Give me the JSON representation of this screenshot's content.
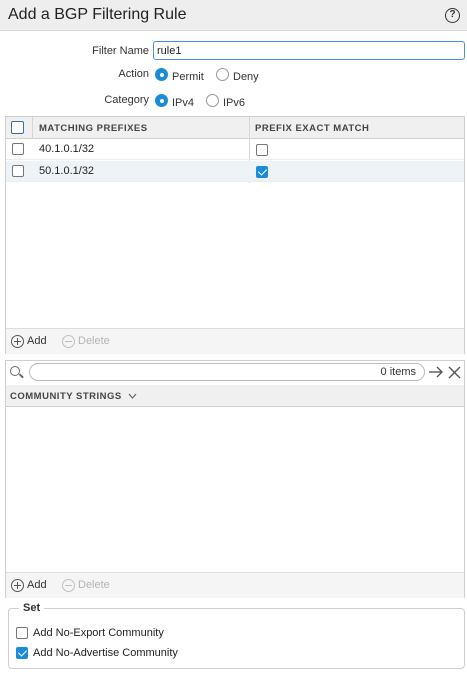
{
  "dialog": {
    "title": "Add a BGP Filtering Rule",
    "help_icon": "help-icon"
  },
  "form": {
    "filter_name_label": "Filter Name",
    "filter_name_value": "rule1",
    "action_label": "Action",
    "action_options": [
      "Permit",
      "Deny"
    ],
    "action_selected": "Permit",
    "category_label": "Category",
    "category_options": [
      "IPv4",
      "IPv6"
    ],
    "category_selected": "IPv4"
  },
  "prefix_grid": {
    "columns": [
      "MATCHING PREFIXES",
      "PREFIX EXACT MATCH"
    ],
    "rows": [
      {
        "prefix": "40.1.0.1/32",
        "exact_match": false
      },
      {
        "prefix": "50.1.0.1/32",
        "exact_match": true
      }
    ],
    "add_label": "Add",
    "delete_label": "Delete"
  },
  "community_grid": {
    "items_count": "0 items",
    "column": "COMMUNITY STRINGS",
    "add_label": "Add",
    "delete_label": "Delete"
  },
  "set_group": {
    "legend": "Set",
    "options": [
      {
        "label": "Add No-Export Community",
        "checked": false
      },
      {
        "label": "Add No-Advertise Community",
        "checked": true
      }
    ]
  },
  "colors": {
    "accent": "#1a8cd8",
    "header_bg": "#eeeeee",
    "grid_header_bg": "#f0f0f0"
  }
}
